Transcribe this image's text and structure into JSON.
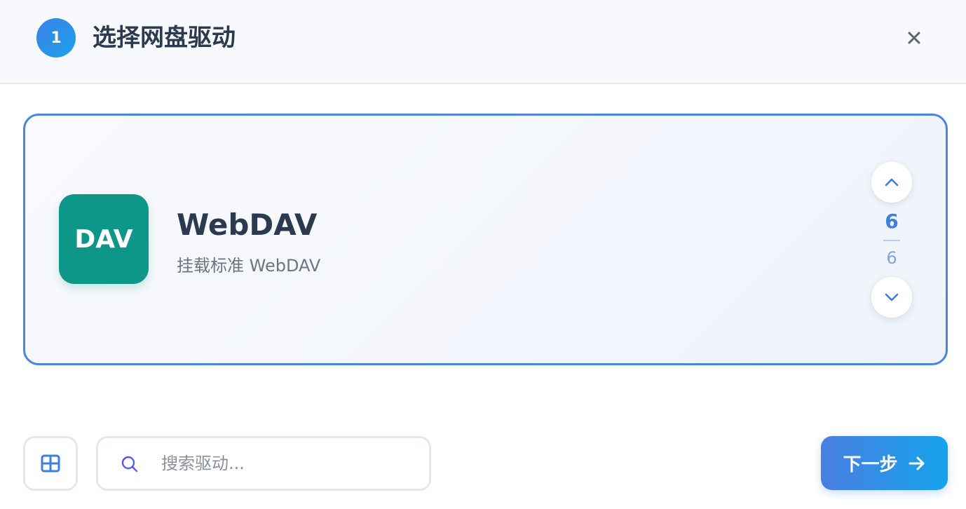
{
  "header": {
    "step_number": "1",
    "title": "选择网盘驱动"
  },
  "drive": {
    "icon_text": "DAV",
    "name": "WebDAV",
    "description": "挂载标准 WebDAV",
    "icon_color": "#0e9688"
  },
  "pager": {
    "current": "6",
    "total": "6"
  },
  "search": {
    "placeholder": "搜索驱动..."
  },
  "footer": {
    "next_label": "下一步"
  },
  "colors": {
    "accent": "#3b7fe0",
    "card_border": "#4a85e0"
  },
  "icons": {
    "close": "close-icon",
    "up": "chevron-up-icon",
    "down": "chevron-down-icon",
    "grid": "grid-icon",
    "search": "search-icon",
    "arrow": "arrow-right-icon"
  }
}
